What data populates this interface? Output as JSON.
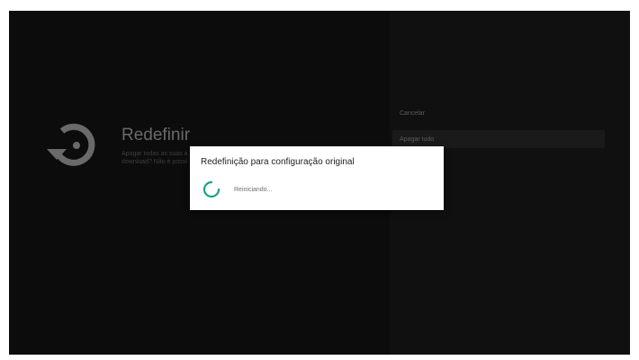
{
  "settings": {
    "title": "Redefinir",
    "description_line1": "Apagar todas as suas a",
    "description_line2": "download? Não é possí",
    "icon": "restore-icon"
  },
  "options": {
    "cancel_label": "Cancelar",
    "erase_all_label": "Apagar tudo"
  },
  "dialog": {
    "title": "Redefinição para configuração original",
    "status": "Reiniciando...",
    "spinner_color": "#1aa18a"
  }
}
